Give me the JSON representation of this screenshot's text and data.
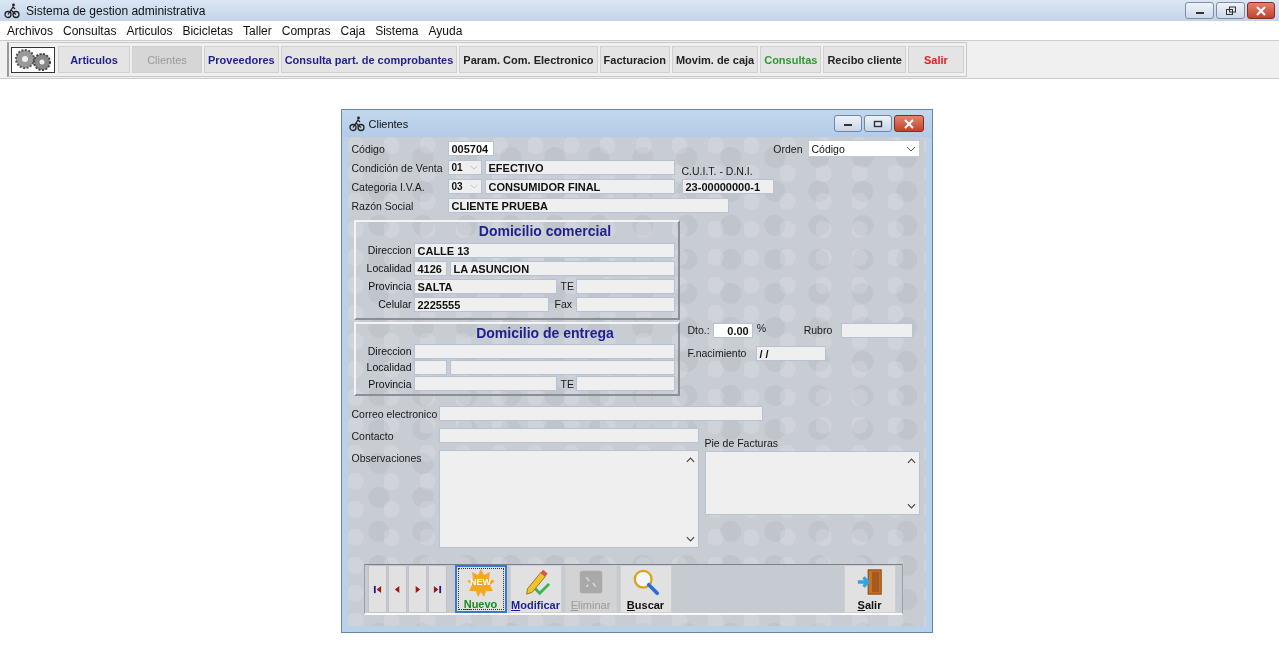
{
  "window": {
    "title": "Sistema de gestion administrativa"
  },
  "menu": [
    "Archivos",
    "Consultas",
    "Articulos",
    "Bicicletas",
    "Taller",
    "Compras",
    "Caja",
    "Sistema",
    "Ayuda"
  ],
  "toolbar": [
    {
      "label": "Articulos",
      "color": "#1f1f8f",
      "disabled": false
    },
    {
      "label": "Clientes",
      "disabled": true
    },
    {
      "label": "Proveedores",
      "color": "#1f1f8f",
      "disabled": false
    },
    {
      "label": "Consulta part. de comprobantes",
      "color": "#1f1f8f",
      "disabled": false
    },
    {
      "label": "Param. Com. Electronico",
      "color": "#222222",
      "disabled": false
    },
    {
      "label": "Facturacion",
      "color": "#222222",
      "disabled": false
    },
    {
      "label": "Movim. de caja",
      "color": "#222222",
      "disabled": false
    },
    {
      "label": "Consultas",
      "color": "#2e9a2e",
      "disabled": false
    },
    {
      "label": "Recibo cliente",
      "color": "#222222",
      "disabled": false
    },
    {
      "label": "Salir",
      "color": "#e02020",
      "disabled": false
    }
  ],
  "dialog": {
    "title": "Clientes",
    "codigo": {
      "label": "Código",
      "value": "005704"
    },
    "orden": {
      "label": "Orden",
      "value": "Código"
    },
    "condicion": {
      "label": "Condición de Venta",
      "code": "01",
      "value": "EFECTIVO"
    },
    "cuit": {
      "label": "C.U.I.T. - D.N.I.",
      "value": "23-00000000-1"
    },
    "categoria": {
      "label": "Categoria I.V.A.",
      "code": "03",
      "value": "CONSUMIDOR FINAL"
    },
    "razon": {
      "label": "Razón Social",
      "value": "CLIENTE PRUEBA"
    },
    "comercial": {
      "title": "Domicilio comercial",
      "direccion_label": "Direccion",
      "direccion": "CALLE 13",
      "localidad_label": "Localidad",
      "cp": "4126",
      "localidad": "LA ASUNCION",
      "provincia_label": "Provincia",
      "provincia": "SALTA",
      "te_label": "TE",
      "celular_label": "Celular",
      "celular": "2225555",
      "fax_label": "Fax"
    },
    "entrega": {
      "title": "Domicilio de entrega",
      "direccion_label": "Direccion",
      "localidad_label": "Localidad",
      "provincia_label": "Provincia",
      "te_label": "TE"
    },
    "dto": {
      "label": "Dto.:",
      "value": "0.00",
      "unit": "%"
    },
    "rubro": {
      "label": "Rubro"
    },
    "nacimiento": {
      "label": "F.nacimiento",
      "value": "/ /"
    },
    "correo": {
      "label": "Correo electronico"
    },
    "contacto": {
      "label": "Contacto"
    },
    "pie": {
      "label": "Pie de Facturas"
    },
    "observaciones": {
      "label": "Observaciones"
    },
    "actions": [
      {
        "kind": "new",
        "label": "Nuevo",
        "badge": "NEW",
        "color": "#1e8a1e",
        "disabled": false,
        "focused": true
      },
      {
        "kind": "edit",
        "label": "Modificar",
        "color": "#1f1f8f",
        "disabled": false,
        "focused": false
      },
      {
        "kind": "delete",
        "label": "Eliminar",
        "disabled": true,
        "focused": false
      },
      {
        "kind": "search",
        "label": "Buscar",
        "color": "#111111",
        "disabled": false,
        "focused": false
      },
      {
        "kind": "exit",
        "label": "Salir",
        "color": "#111111",
        "disabled": false,
        "focused": false
      }
    ]
  }
}
